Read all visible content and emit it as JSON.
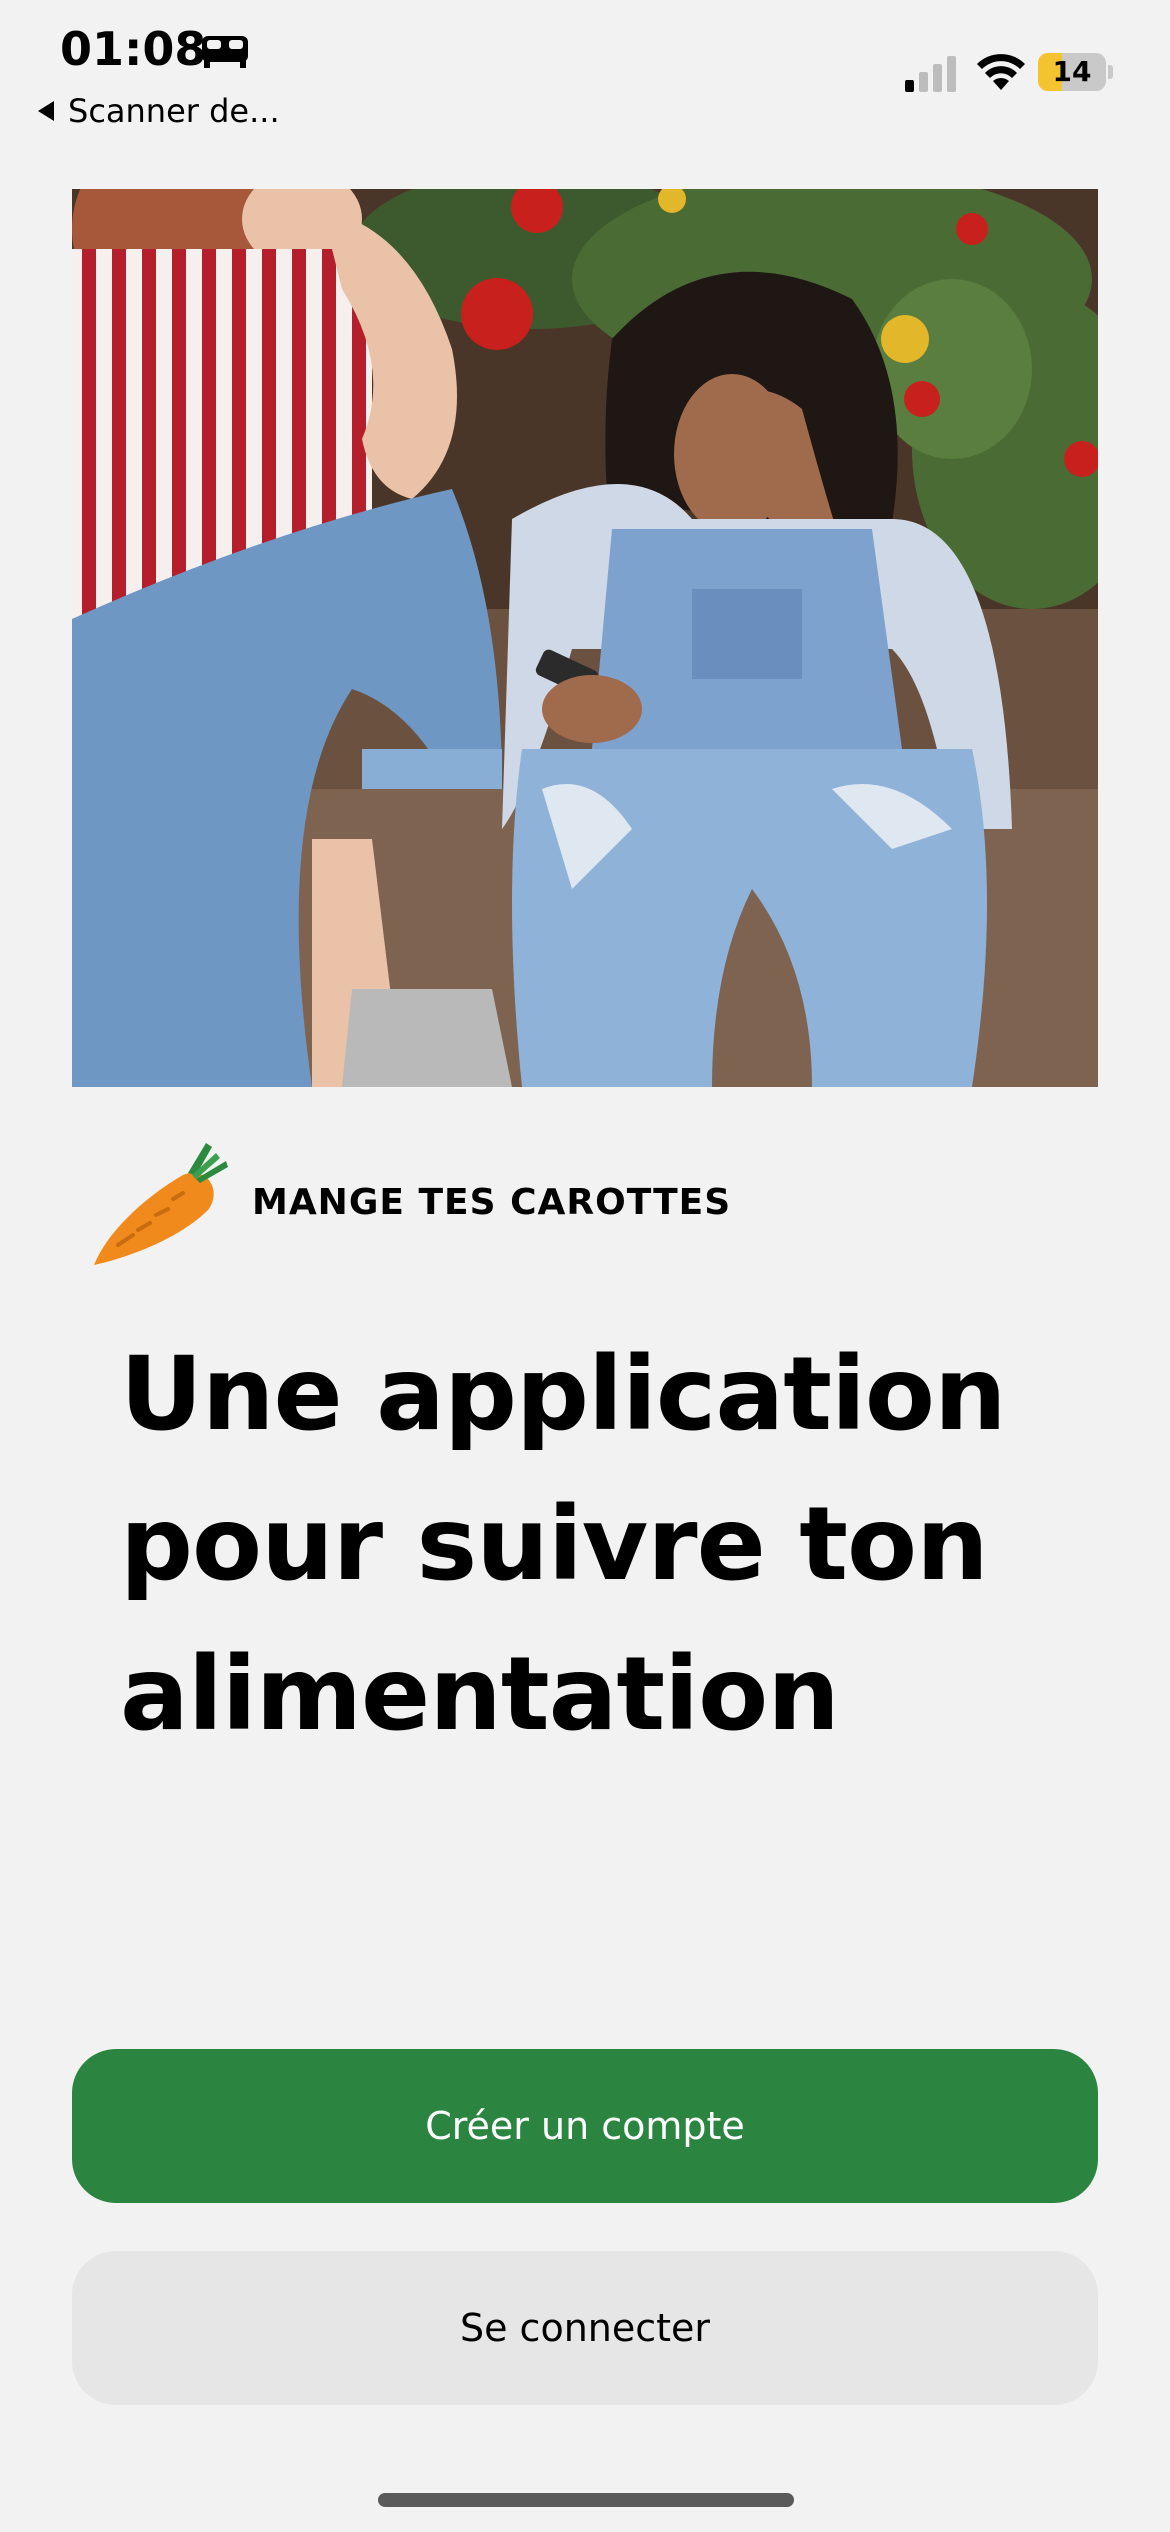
{
  "status_bar": {
    "time": "01:08",
    "back_label": "Scanner de...",
    "battery_percent": "14",
    "battery_level": 0.14,
    "icons": [
      "bed-icon",
      "signal-icon",
      "wifi-icon",
      "battery-icon"
    ]
  },
  "brand": {
    "name": "MANGE TES CAROTTES",
    "logo_icon": "carrot-icon"
  },
  "headline": "Une application pour suivre ton alimentation",
  "actions": {
    "primary_label": "Créer un compte",
    "secondary_label": "Se connecter"
  },
  "colors": {
    "background": "#f2f2f2",
    "primary": "#2b8540",
    "secondary": "#e6e6e6",
    "carrot": "#f08a1c",
    "carrot_leaf": "#2a8a3e",
    "battery_low": "#f4c430"
  }
}
